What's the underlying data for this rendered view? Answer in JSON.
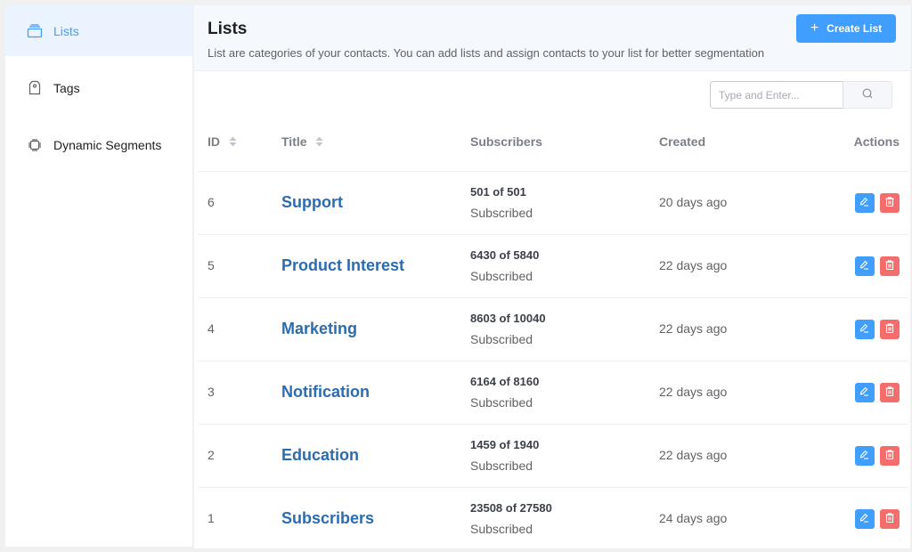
{
  "sidebar": {
    "items": [
      {
        "label": "Lists",
        "icon": "stack-icon",
        "active": true
      },
      {
        "label": "Tags",
        "icon": "tag-icon",
        "active": false
      },
      {
        "label": "Dynamic Segments",
        "icon": "chip-icon",
        "active": false
      }
    ]
  },
  "header": {
    "title": "Lists",
    "description": "List are categories of your contacts. You can add lists and assign contacts to your list for better segmentation",
    "create_button_label": "Create List"
  },
  "search": {
    "placeholder": "Type and Enter...",
    "value": ""
  },
  "table": {
    "columns": {
      "id": "ID",
      "title": "Title",
      "subscribers": "Subscribers",
      "created": "Created",
      "actions": "Actions"
    },
    "rows": [
      {
        "id": "6",
        "title": "Support",
        "subscribers": "501 of 501",
        "status": "Subscribed",
        "created": "20 days ago"
      },
      {
        "id": "5",
        "title": "Product Interest",
        "subscribers": "6430 of 5840",
        "status": "Subscribed",
        "created": "22 days ago"
      },
      {
        "id": "4",
        "title": "Marketing",
        "subscribers": "8603 of 10040",
        "status": "Subscribed",
        "created": "22 days ago"
      },
      {
        "id": "3",
        "title": "Notification",
        "subscribers": "6164 of 8160",
        "status": "Subscribed",
        "created": "22 days ago"
      },
      {
        "id": "2",
        "title": "Education",
        "subscribers": "1459 of 1940",
        "status": "Subscribed",
        "created": "22 days ago"
      },
      {
        "id": "1",
        "title": "Subscribers",
        "subscribers": "23508 of 27580",
        "status": "Subscribed",
        "created": "24 days ago"
      }
    ]
  },
  "colors": {
    "primary": "#409eff",
    "danger": "#f56c6c",
    "link": "#2b6cb0",
    "active_bg": "#ebf3fe"
  }
}
